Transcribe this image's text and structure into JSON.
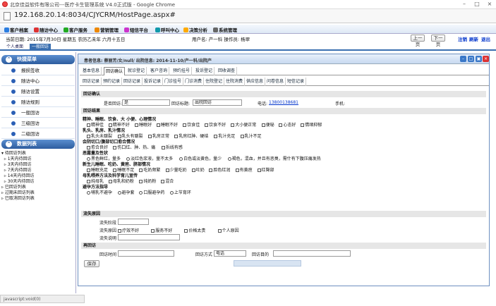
{
  "window": {
    "title": "北京佳益软件有限公司---医疗卡生管理系统 V4.0正式版 - Google Chrome",
    "url": "192.168.20.14:8034/CJYCRM/HostPage.aspx#"
  },
  "menu": [
    {
      "label": "客户档案",
      "icon": "folder-icon",
      "color": "#2b7de0"
    },
    {
      "label": "随访中心",
      "icon": "phone-icon",
      "color": "#d33"
    },
    {
      "label": "客户服务",
      "icon": "service-icon",
      "color": "#2a2"
    },
    {
      "label": "营销管理",
      "icon": "chart-icon",
      "color": "#e80"
    },
    {
      "label": "短信平台",
      "icon": "mail-icon",
      "color": "#c3c"
    },
    {
      "label": "呼叫中心",
      "icon": "headset-icon",
      "color": "#19a"
    },
    {
      "label": "决策分析",
      "icon": "pie-icon",
      "color": "#fa0"
    },
    {
      "label": "系统管理",
      "icon": "gear-icon",
      "color": "#666"
    }
  ],
  "info": {
    "date": "当前日期: 2015年7月30日 星期五 农历乙未年 六月十五日",
    "user": "用户名: 产一科 操作员: 杨翠"
  },
  "buttons": {
    "prev": "上一页",
    "next": "下一页",
    "logout": "注销",
    "refresh": "刷新",
    "exit": "退出",
    "save": "保存"
  },
  "top_tabs": [
    "个人桌面",
    "一般回访"
  ],
  "sidebar": {
    "quick_title": "快捷菜单",
    "quick_items": [
      "报损签收",
      "随访中心",
      "随访设置",
      "随访规则",
      "一般回访",
      "三级回访",
      "二级回访"
    ],
    "list_title": "数据列表",
    "tree": [
      "▾ 待回访列表",
      "  ▹ 1天内待回访",
      "  ▹ 3天内待回访",
      "  ▹ 7天内待回访",
      "  ▹ 14天内待回访",
      "  ▹ 30天内待回访",
      "▹ 已回访列表",
      "▹ 过期未回访列表",
      "▹ 已取消回访列表"
    ]
  },
  "main": {
    "patient_info": "患者信息: 蔡丽芳/女/null/ 出院信息: 2014-11-10/产一科/出院产",
    "tabs": [
      "基本信息",
      "回访确认",
      "就诊登记",
      "客户咨询",
      "预约挂号",
      "投诉登记",
      "回收调查"
    ],
    "subtabs": [
      "回访记录",
      "预约记录",
      "回访记录",
      "投诉记录",
      "门诊挂号",
      "门诊消费",
      "住院登记",
      "住院消费",
      "供应信息",
      "问卷信息",
      "短信记录"
    ],
    "confirm": {
      "title": "回访确认",
      "label1": "是否回访:",
      "val1": "是",
      "label2": "回访标题:",
      "val2": "出院回访",
      "phone_label": "电话:",
      "phone": "13800138681",
      "mobile_label": "手机:"
    },
    "content": {
      "title": "回访结果",
      "rows": [
        {
          "type": "h",
          "text": "精神、睡眠、饮食、大 小便、心理情况"
        },
        {
          "type": "c",
          "items": [
            "精神佳",
            "精神不好",
            "睡眠好",
            "睡眠不好",
            "饮食佳",
            "饮食不好",
            "大小便正常",
            "便秘",
            "心态好",
            "情绪抑郁"
          ]
        },
        {
          "type": "h",
          "text": "乳头、乳房、乳汁情况"
        },
        {
          "type": "c",
          "items": [
            "乳头未皲裂",
            "乳头有皲裂",
            "乳房正常",
            "乳房红肿、硬结",
            "乳汁充足",
            "乳汁不足"
          ]
        },
        {
          "type": "h",
          "text": "会阴切口/腹部切口愈合情况"
        },
        {
          "type": "c",
          "items": [
            "愈合良好",
            "伤口红、肿、热、痛",
            "拆线有感"
          ]
        },
        {
          "type": "h",
          "text": "恶露量及性状"
        },
        {
          "type": "r",
          "items": [
            "黑色鲜红，量多",
            "淡红色浆液，量不太多",
            "白色或淡黄色，量少",
            "褐色，混血，并且有恶臭，需什有下腹压痛发热"
          ]
        },
        {
          "type": "h",
          "text": "新生儿睡眠、吃奶、黄疸、脐部情况"
        },
        {
          "type": "c",
          "items": [
            "睡眠充足",
            "睡眠不足",
            "吃奶频繁",
            "少量吃奶",
            "吐奶",
            "脸色红润",
            "有黄疸",
            "红臀部"
          ]
        },
        {
          "type": "h",
          "text": "母乳喂养方法及科学育儿宣传"
        },
        {
          "type": "c",
          "items": [
            "纯母乳",
            "母乳和奶粉",
            "纯奶粉",
            "混合"
          ]
        },
        {
          "type": "h",
          "text": "避孕方法指导"
        },
        {
          "type": "r",
          "items": [
            "哺乳不避孕",
            "避孕套",
            "口服避孕药",
            "上节育环"
          ]
        }
      ]
    },
    "loss": {
      "title": "流失原因",
      "stage_label": "流失阶段",
      "reason_label": "流失原因",
      "reasons": [
        "疗效不好",
        "服务不好",
        "价格太贵",
        "个人原因"
      ],
      "note_label": "流失说明"
    },
    "plan": {
      "title": "再回访",
      "time_label": "回访时间",
      "method_label": "回访方式",
      "method_val": "电话",
      "purpose_label": "回访目的"
    }
  },
  "status": "javascript:void(0)"
}
